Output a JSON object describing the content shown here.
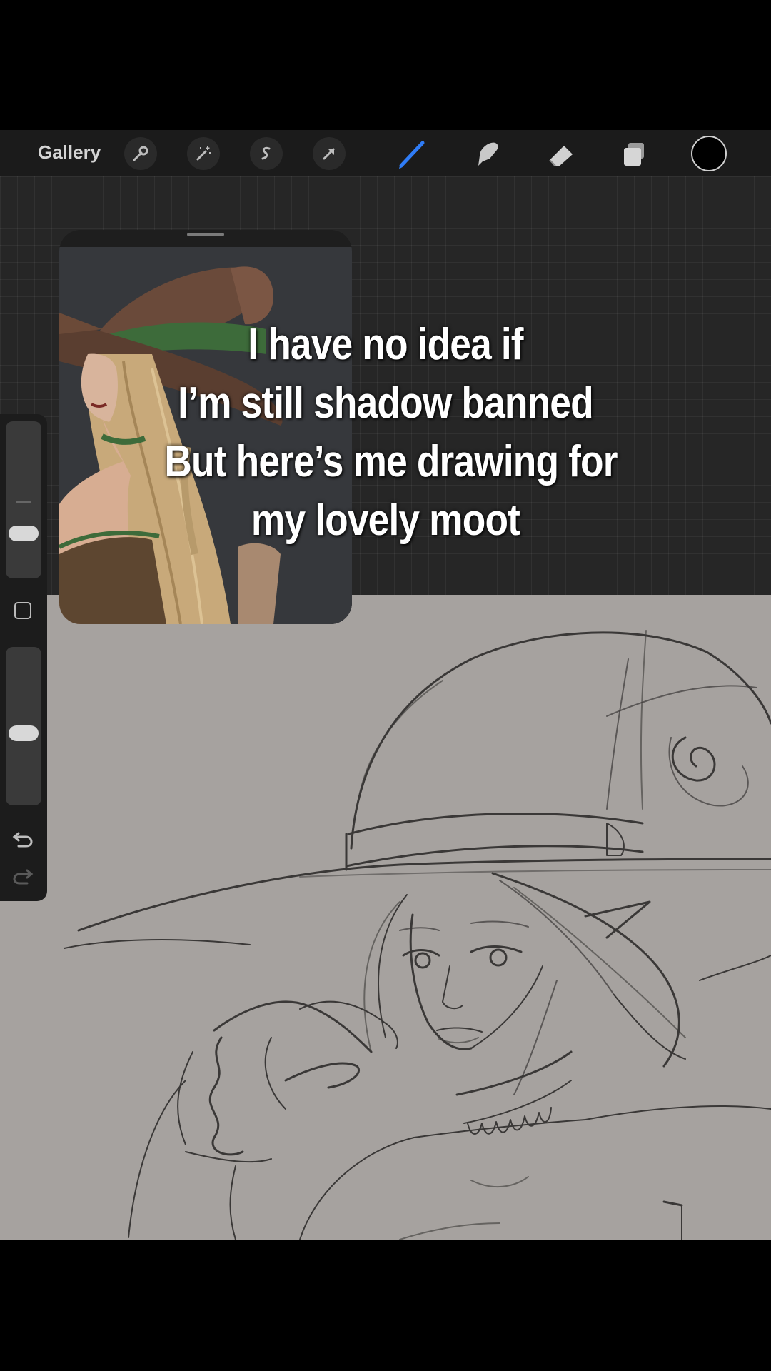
{
  "toolbar": {
    "gallery_label": "Gallery",
    "icons": [
      "wrench-icon",
      "magic-wand-icon",
      "selection-icon",
      "transform-arrow-icon",
      "brush-icon",
      "smudge-icon",
      "eraser-icon",
      "layers-icon",
      "color-swatch"
    ],
    "active_tool": "brush",
    "active_color": "#000000",
    "accent": "#2f7cf6"
  },
  "caption": {
    "line1": "I have no idea if",
    "line2": "I’m still shadow banned",
    "line3": "But here’s me drawing for",
    "line4": "my lovely moot"
  },
  "sidebar": {
    "brush_size_level": 0.25,
    "opacity_level": 0.45
  }
}
